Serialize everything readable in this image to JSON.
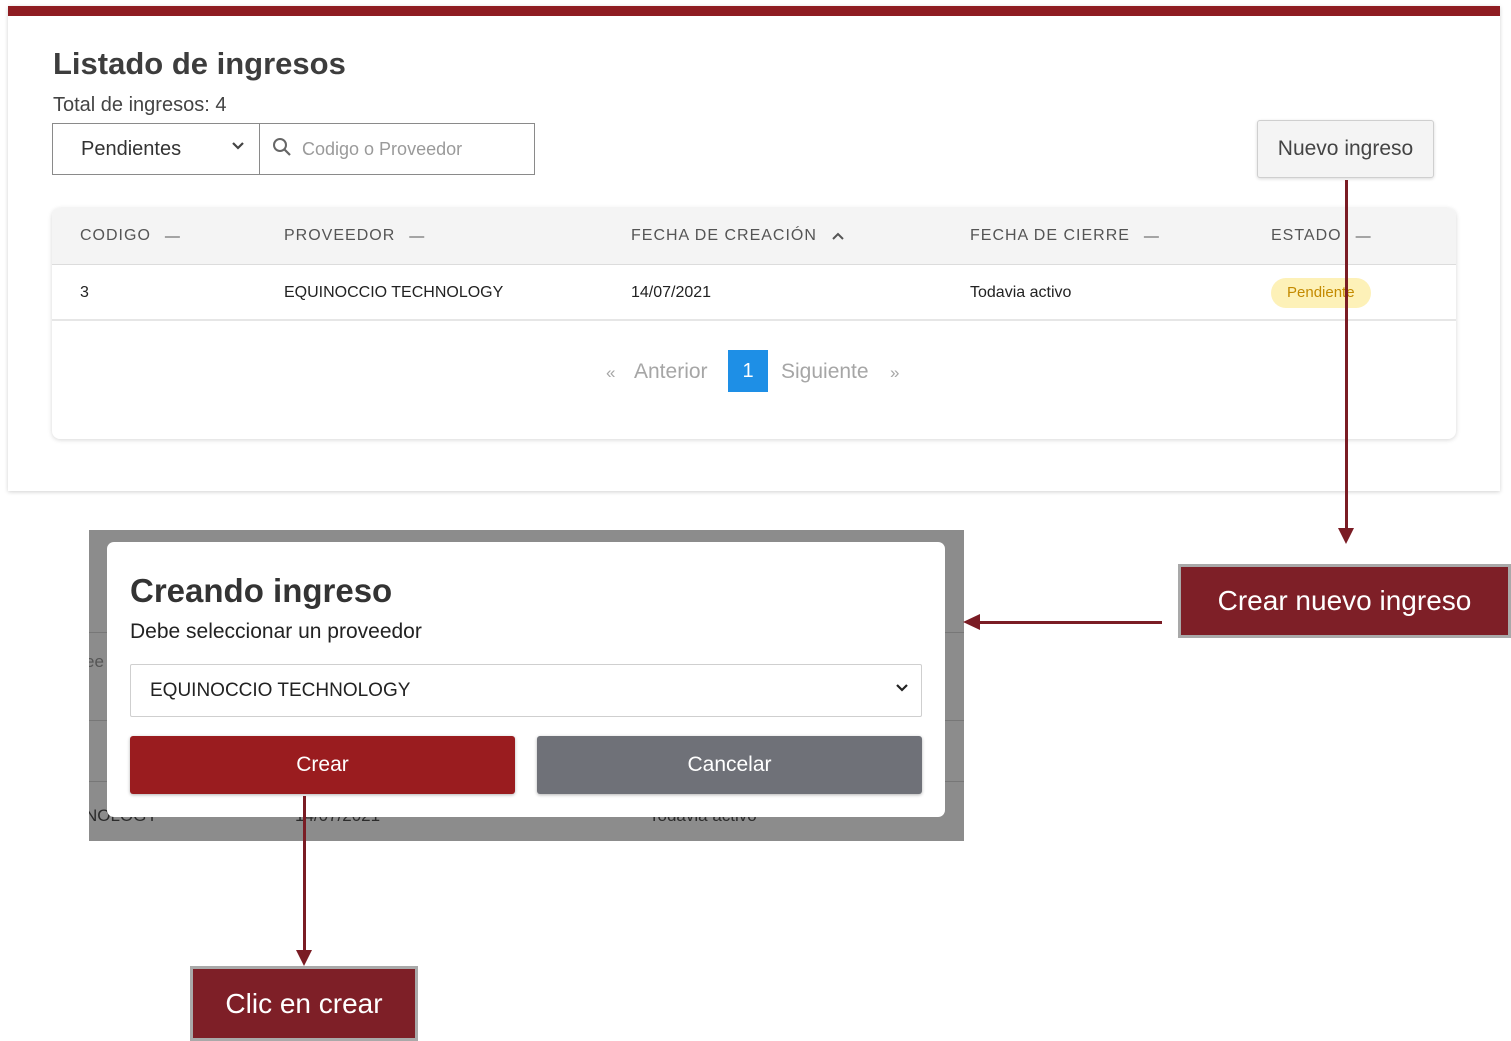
{
  "page": {
    "title": "Listado de ingresos",
    "total_label": "Total de ingresos: 4"
  },
  "filters": {
    "status_selected": "Pendientes",
    "search_placeholder": "Codigo o Proveedor"
  },
  "actions": {
    "new_button": "Nuevo ingreso"
  },
  "table": {
    "columns": [
      {
        "label": "CODIGO",
        "sort": "—"
      },
      {
        "label": "PROVEEDOR",
        "sort": "—"
      },
      {
        "label": "FECHA DE CREACIÓN",
        "sort": "^"
      },
      {
        "label": "FECHA DE CIERRE",
        "sort": "—"
      },
      {
        "label": "ESTADO",
        "sort": "—"
      }
    ],
    "rows": [
      {
        "codigo": "3",
        "proveedor": "EQUINOCCIO TECHNOLOGY",
        "fecha_creacion": "14/07/2021",
        "fecha_cierre": "Todavia activo",
        "estado": "Pendiente"
      }
    ]
  },
  "pagination": {
    "prev_symbol": "«",
    "prev_label": "Anterior",
    "current_page": "1",
    "next_label": "Siguiente",
    "next_symbol": "»"
  },
  "modal": {
    "title": "Creando ingreso",
    "subtitle": "Debe seleccionar un proveedor",
    "provider_selected": "EQUINOCCIO TECHNOLOGY",
    "create_button": "Crear",
    "cancel_button": "Cancelar",
    "background_fragments": [
      "ee",
      "NOLOGY",
      "14/07/2021",
      "Todavia activo"
    ]
  },
  "callouts": {
    "new_income": "Crear nuevo ingreso",
    "click_create": "Clic en crear"
  },
  "colors": {
    "brand": "#8f1d22",
    "callout_bg": "#7e1f27",
    "create_button": "#9a1c1f",
    "cancel_button": "#6f7178",
    "active_page": "#1e8fe6",
    "badge_bg": "#fdf1b8",
    "badge_text": "#c48a00"
  },
  "icons": {
    "search": "search-icon",
    "dropdown": "chevron-down-icon",
    "sort_asc": "chevron-up-icon"
  }
}
